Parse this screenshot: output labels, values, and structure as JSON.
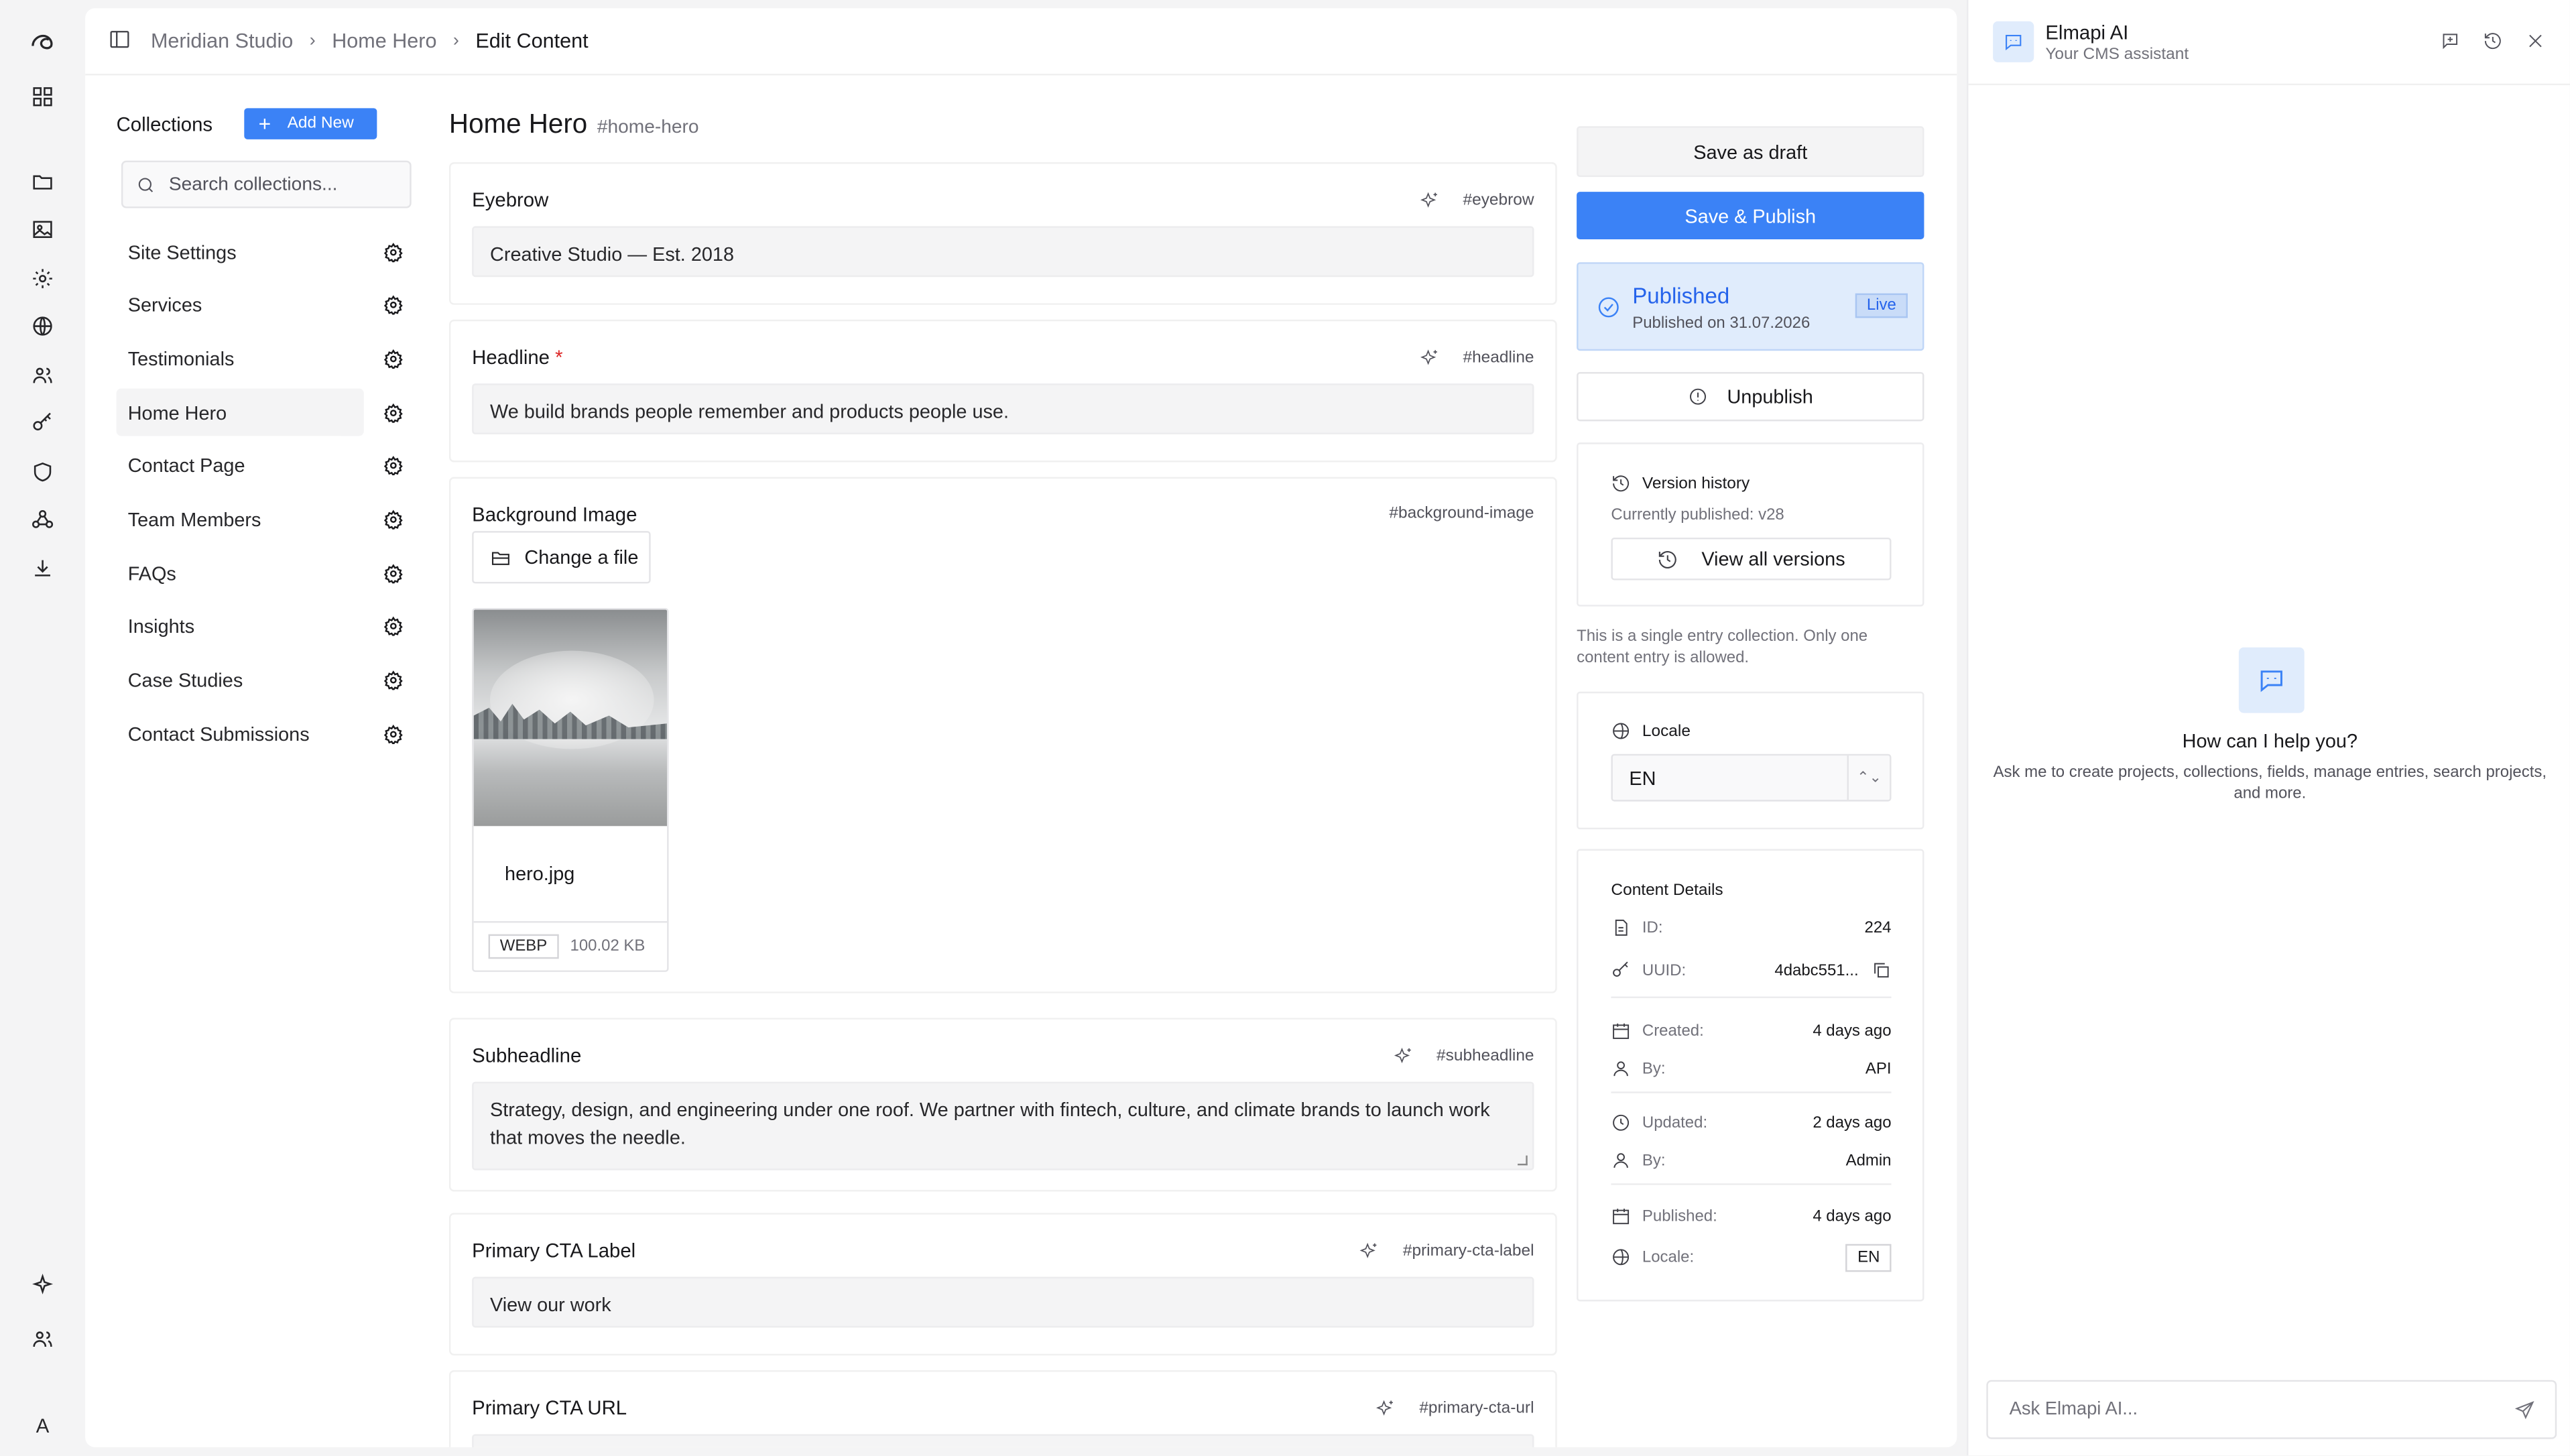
{
  "breadcrumb": [
    "Meridian Studio",
    "Home Hero",
    "Edit Content"
  ],
  "collections": {
    "title": "Collections",
    "add_label": "Add New",
    "search_placeholder": "Search collections...",
    "items": [
      "Site Settings",
      "Services",
      "Testimonials",
      "Home Hero",
      "Contact Page",
      "Team Members",
      "FAQs",
      "Insights",
      "Case Studies",
      "Contact Submissions"
    ],
    "active": "Home Hero"
  },
  "entry": {
    "title": "Home Hero",
    "slug": "#home-hero",
    "fields": {
      "eyebrow": {
        "label": "Eyebrow",
        "slug": "#eyebrow",
        "value": "Creative Studio — Est. 2018"
      },
      "headline": {
        "label": "Headline",
        "required": "*",
        "slug": "#headline",
        "value": "We build brands people remember and products people use."
      },
      "background": {
        "label": "Background Image",
        "slug": "#background-image",
        "button": "Change a file",
        "file_name": "hero.jpg",
        "format": "WEBP",
        "size": "100.02 KB"
      },
      "subheadline": {
        "label": "Subheadline",
        "slug": "#subheadline",
        "value": "Strategy, design, and engineering under one roof. We partner with fintech, culture, and climate brands to launch work that moves the needle."
      },
      "cta_label": {
        "label": "Primary CTA Label",
        "slug": "#primary-cta-label",
        "value": "View our work"
      },
      "cta_url": {
        "label": "Primary CTA URL",
        "slug": "#primary-cta-url"
      }
    }
  },
  "actions": {
    "draft": "Save as draft",
    "publish": "Save & Publish",
    "status_title": "Published",
    "status_sub": "Published on 31.07.2026",
    "status_badge": "Live",
    "unpublish": "Unpublish"
  },
  "versions": {
    "title": "Version history",
    "current": "Currently published: v28",
    "button": "View all versions"
  },
  "note": "This is a single entry collection. Only one content entry is allowed.",
  "locale": {
    "title": "Locale",
    "value": "EN"
  },
  "details": {
    "title": "Content Details",
    "id_k": "ID:",
    "id_v": "224",
    "uuid_k": "UUID:",
    "uuid_v": "4dabc551...",
    "created_k": "Created:",
    "created_v": "4 days ago",
    "created_by_k": "By:",
    "created_by_v": "API",
    "updated_k": "Updated:",
    "updated_v": "2 days ago",
    "updated_by_k": "By:",
    "updated_by_v": "Admin",
    "published_k": "Published:",
    "published_v": "4 days ago",
    "locale_k": "Locale:",
    "locale_v": "EN"
  },
  "ai": {
    "name": "Elmapi AI",
    "subtitle": "Your CMS assistant",
    "question": "How can I help you?",
    "description": "Ask me to create projects, collections, fields, manage entries, search projects, and more.",
    "placeholder": "Ask Elmapi AI..."
  },
  "user_initial": "A"
}
